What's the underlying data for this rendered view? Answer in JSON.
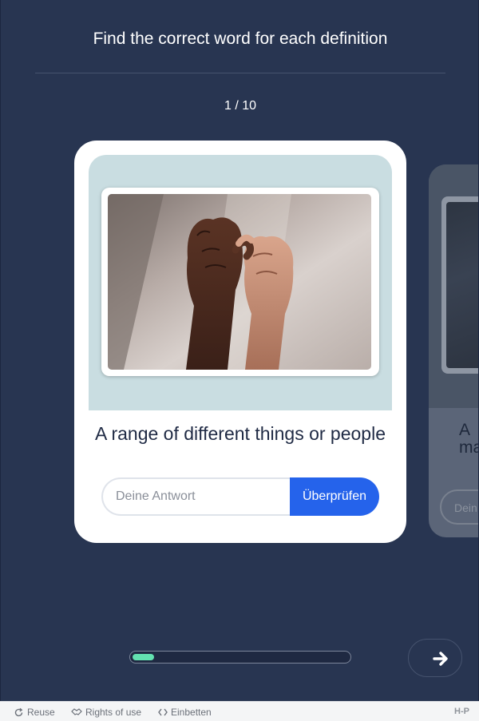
{
  "header": {
    "title": "Find the correct word for each definition",
    "counter": "1 / 10"
  },
  "card": {
    "definition": "A range of different things or people",
    "input_placeholder": "Deine Antwort",
    "check_label": "Überprüfen",
    "image_icon": "linked-pinky-fingers-photo"
  },
  "next_card": {
    "definition_fragment": "A\nma",
    "input_placeholder": "Dein"
  },
  "progress": {
    "current": 1,
    "total": 10,
    "fill_fraction": 0.1,
    "fill_color": "#63e1b0"
  },
  "navigation": {
    "next_icon": "arrow-right-icon"
  },
  "footer": {
    "reuse_label": "Reuse",
    "rights_label": "Rights of use",
    "embed_label": "Einbetten",
    "logo_text": "H-P"
  },
  "colors": {
    "background": "#283551",
    "accent": "#2563eb",
    "card_image_bg": "#c9dde1"
  }
}
